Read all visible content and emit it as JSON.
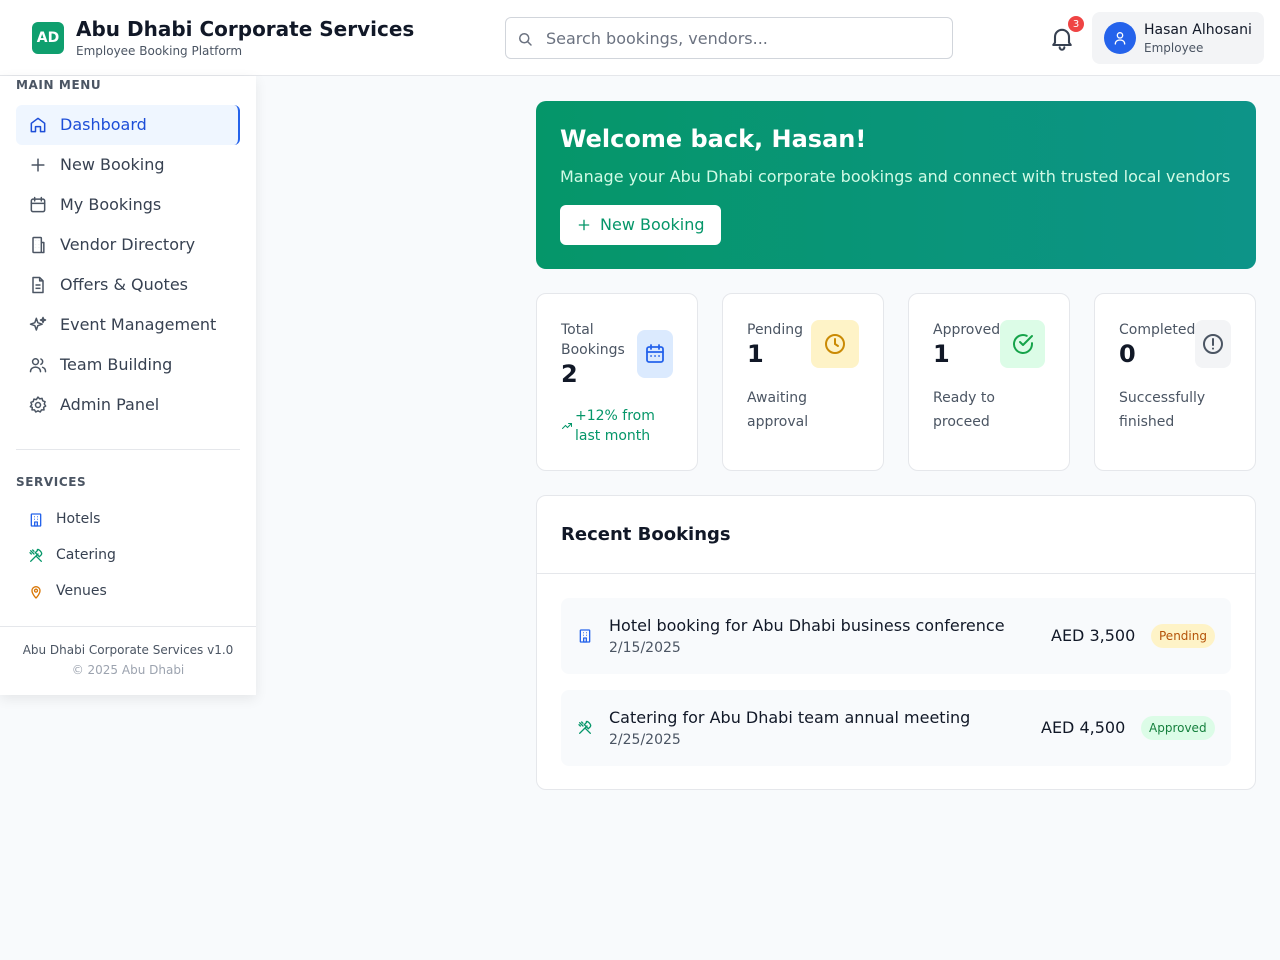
{
  "header": {
    "logo_text": "AD",
    "title": "Abu Dhabi Corporate Services",
    "subtitle": "Employee Booking Platform",
    "search_placeholder": "Search bookings, vendors...",
    "notification_count": "3",
    "user_name": "Hasan Alhosani",
    "user_role": "Employee"
  },
  "sidebar": {
    "main_menu_label": "MAIN MENU",
    "items": [
      {
        "label": "Dashboard",
        "icon": "home-icon",
        "active": true
      },
      {
        "label": "New Booking",
        "icon": "plus-icon"
      },
      {
        "label": "My Bookings",
        "icon": "calendar-icon"
      },
      {
        "label": "Vendor Directory",
        "icon": "building-icon"
      },
      {
        "label": "Offers & Quotes",
        "icon": "document-icon"
      },
      {
        "label": "Event Management",
        "icon": "sparkles-icon"
      },
      {
        "label": "Team Building",
        "icon": "users-icon"
      },
      {
        "label": "Admin Panel",
        "icon": "gear-icon"
      }
    ],
    "services_label": "SERVICES",
    "services": [
      {
        "label": "Hotels",
        "icon": "hotel-icon",
        "color": "#2563eb"
      },
      {
        "label": "Catering",
        "icon": "utensils-icon",
        "color": "#059669"
      },
      {
        "label": "Venues",
        "icon": "map-pin-icon",
        "color": "#d97706"
      }
    ],
    "footer_version": "Abu Dhabi Corporate Services v1.0",
    "footer_copyright": "© 2025 Abu Dhabi"
  },
  "welcome": {
    "title": "Welcome back, Hasan!",
    "text": "Manage your Abu Dhabi corporate bookings and connect with trusted local vendors",
    "button_label": "New Booking"
  },
  "stats": [
    {
      "label": "Total Bookings",
      "value": "2",
      "trend": "+12% from last month",
      "icon": "calendar-icon"
    },
    {
      "label": "Pending",
      "value": "1",
      "sub": "Awaiting approval",
      "icon": "clock-icon"
    },
    {
      "label": "Approved",
      "value": "1",
      "sub": "Ready to proceed",
      "icon": "check-circle-icon"
    },
    {
      "label": "Completed",
      "value": "0",
      "sub": "Successfully finished",
      "icon": "alert-circle-icon"
    }
  ],
  "recent": {
    "title": "Recent Bookings",
    "rows": [
      {
        "description": "Hotel booking for Abu Dhabi business conference",
        "date": "2/15/2025",
        "amount": "AED 3,500",
        "status": "Pending",
        "icon": "hotel-icon"
      },
      {
        "description": "Catering for Abu Dhabi team annual meeting",
        "date": "2/25/2025",
        "amount": "AED 4,500",
        "status": "Approved",
        "icon": "utensils-icon"
      }
    ]
  },
  "colors": {
    "brand": "#0f9f6e",
    "primary": "#2563eb",
    "pending_bg": "#fef3c7",
    "pending_text": "#b45309",
    "approved_bg": "#dcfce7",
    "approved_text": "#15803d"
  }
}
